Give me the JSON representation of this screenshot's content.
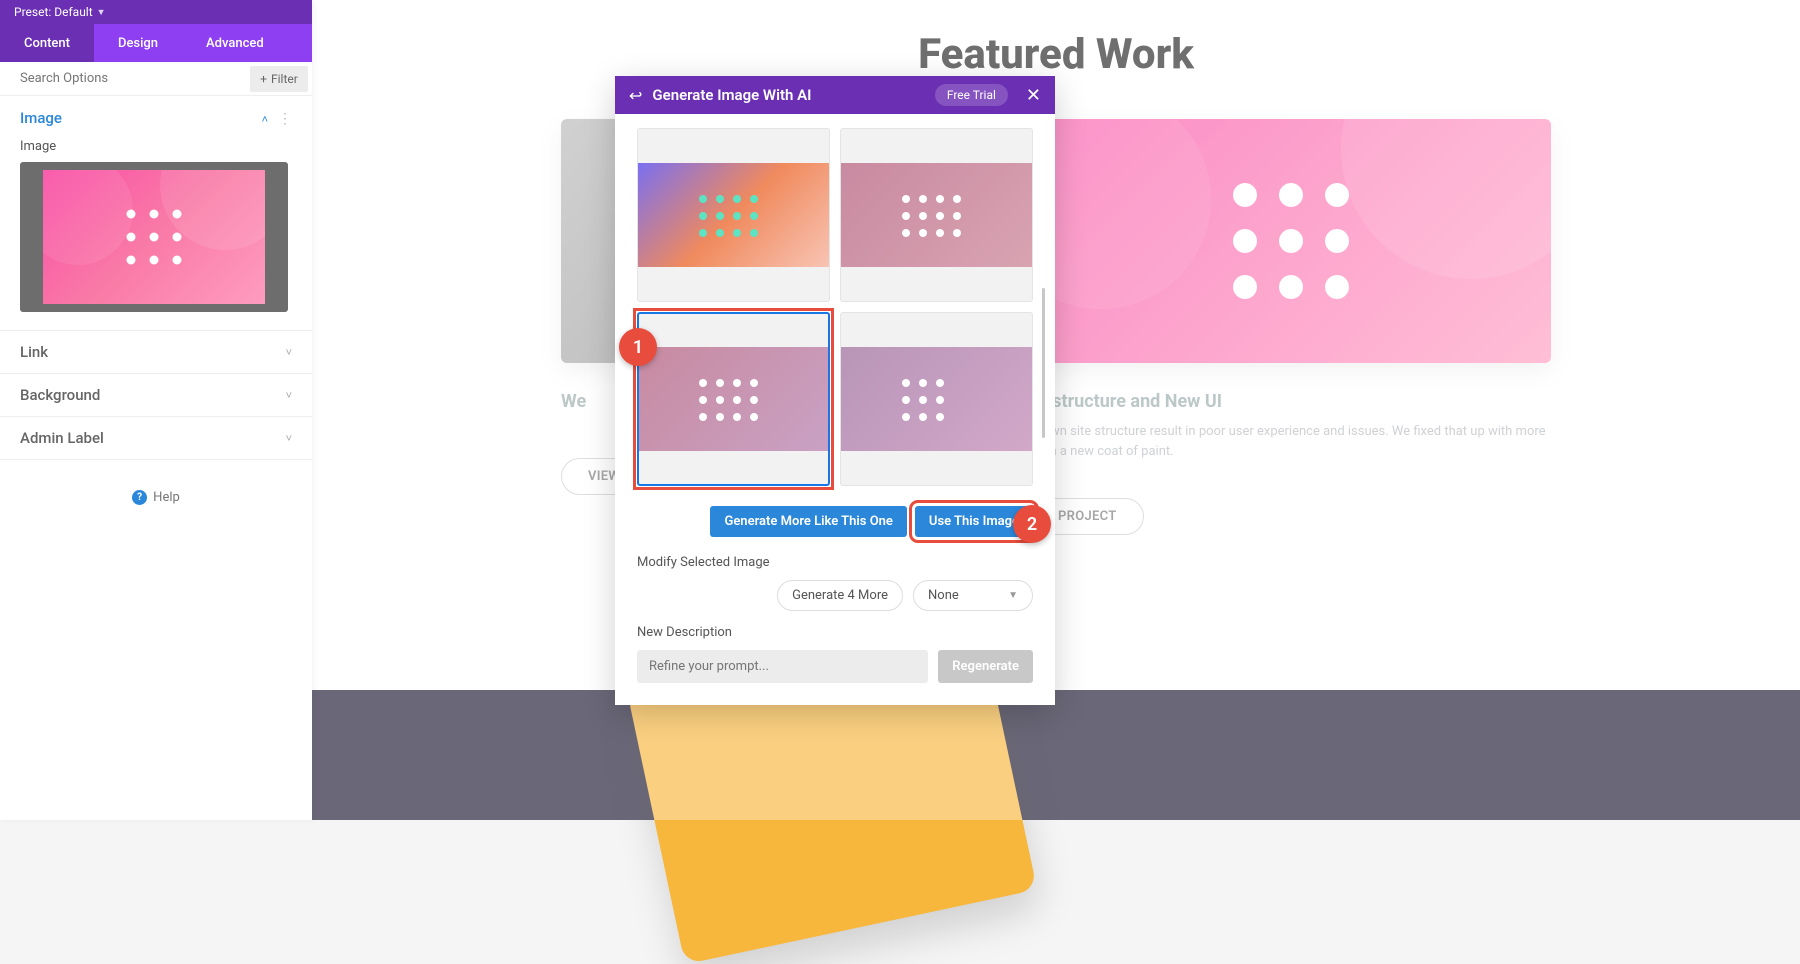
{
  "preset": {
    "label": "Preset: Default"
  },
  "tabs": {
    "content": "Content",
    "design": "Design",
    "advanced": "Advanced"
  },
  "search": {
    "placeholder": "Search Options",
    "filter": "Filter"
  },
  "sections": {
    "image": {
      "title": "Image",
      "field_label": "Image"
    },
    "link": {
      "title": "Link"
    },
    "background": {
      "title": "Background"
    },
    "admin_label": {
      "title": "Admin Label"
    }
  },
  "help": {
    "label": "Help"
  },
  "page": {
    "heading": "Featured Work",
    "card1": {
      "title": "We",
      "text": "",
      "button": "VIEW"
    },
    "card2": {
      "title": "Restructure and New UI",
      "text": "grown site structure result in poor user experience and issues. We fixed that up with more than a new coat of paint.",
      "button": "PROJECT"
    }
  },
  "modal": {
    "title": "Generate Image With AI",
    "trial": "Free Trial",
    "buttons": {
      "more_like": "Generate More Like This One",
      "use_image": "Use This Image",
      "gen4": "Generate 4 More",
      "regen": "Regenerate"
    },
    "labels": {
      "modify": "Modify Selected Image",
      "new_desc": "New Description",
      "none": "None"
    },
    "prompt_placeholder": "Refine your prompt...",
    "callouts": {
      "one": "1",
      "two": "2"
    }
  }
}
